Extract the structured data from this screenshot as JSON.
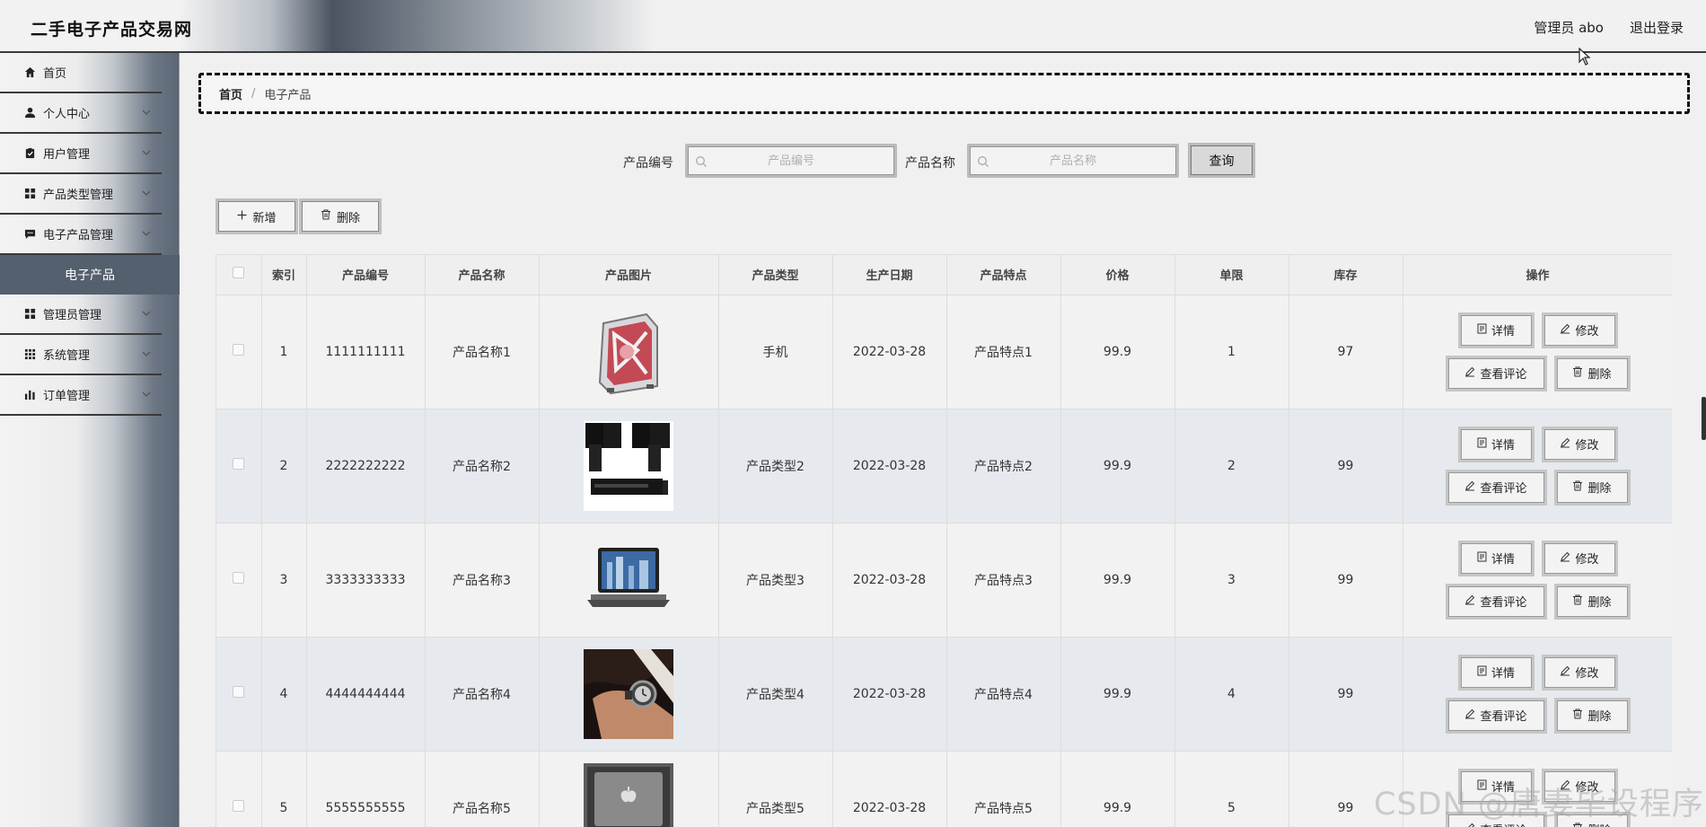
{
  "header": {
    "title": "二手电子产品交易网",
    "user": "管理员 abo",
    "logout": "退出登录"
  },
  "sidebar": {
    "items": [
      {
        "label": "首页",
        "icon": "home-icon"
      },
      {
        "label": "个人中心",
        "icon": "person-icon"
      },
      {
        "label": "用户管理",
        "icon": "clipboard-icon"
      },
      {
        "label": "产品类型管理",
        "icon": "grid-icon"
      },
      {
        "label": "电子产品管理",
        "icon": "chat-icon"
      },
      {
        "label": "管理员管理",
        "icon": "grid-icon"
      },
      {
        "label": "系统管理",
        "icon": "apps-icon"
      },
      {
        "label": "订单管理",
        "icon": "bar-chart-icon"
      }
    ],
    "active_sub": "电子产品"
  },
  "breadcrumb": {
    "home": "首页",
    "sep": "/",
    "current": "电子产品"
  },
  "search": {
    "code_label": "产品编号",
    "code_placeholder": "产品编号",
    "name_label": "产品名称",
    "name_placeholder": "产品名称",
    "query": "查询"
  },
  "actions": {
    "add": "新增",
    "delete": "删除"
  },
  "table": {
    "headers": [
      "索引",
      "产品编号",
      "产品名称",
      "产品图片",
      "产品类型",
      "生产日期",
      "产品特点",
      "价格",
      "单限",
      "库存",
      "操作"
    ],
    "rows": [
      {
        "index": "1",
        "code": "1111111111",
        "name": "产品名称1",
        "image": "pc-case",
        "type": "手机",
        "date": "2022-03-28",
        "feature": "产品特点1",
        "price": "99.9",
        "limit": "1",
        "stock": "97"
      },
      {
        "index": "2",
        "code": "2222222222",
        "name": "产品名称2",
        "image": "speakers",
        "type": "产品类型2",
        "date": "2022-03-28",
        "feature": "产品特点2",
        "price": "99.9",
        "limit": "2",
        "stock": "99"
      },
      {
        "index": "3",
        "code": "3333333333",
        "name": "产品名称3",
        "image": "laptop",
        "type": "产品类型3",
        "date": "2022-03-28",
        "feature": "产品特点3",
        "price": "99.9",
        "limit": "3",
        "stock": "99"
      },
      {
        "index": "4",
        "code": "4444444444",
        "name": "产品名称4",
        "image": "watch",
        "type": "产品类型4",
        "date": "2022-03-28",
        "feature": "产品特点4",
        "price": "99.9",
        "limit": "4",
        "stock": "99"
      },
      {
        "index": "5",
        "code": "5555555555",
        "name": "产品名称5",
        "image": "macbook",
        "type": "产品类型5",
        "date": "2022-03-28",
        "feature": "产品特点5",
        "price": "99.9",
        "limit": "5",
        "stock": "99"
      }
    ],
    "ops": {
      "detail": "详情",
      "edit": "修改",
      "comments": "查看评论",
      "delete": "删除"
    }
  },
  "watermark": "CSDN @唐妻毕设程序",
  "colors": {
    "sidebar_active": "#55606e",
    "header_dark": "#4a5462",
    "row_alt": "#e6e9ed"
  }
}
